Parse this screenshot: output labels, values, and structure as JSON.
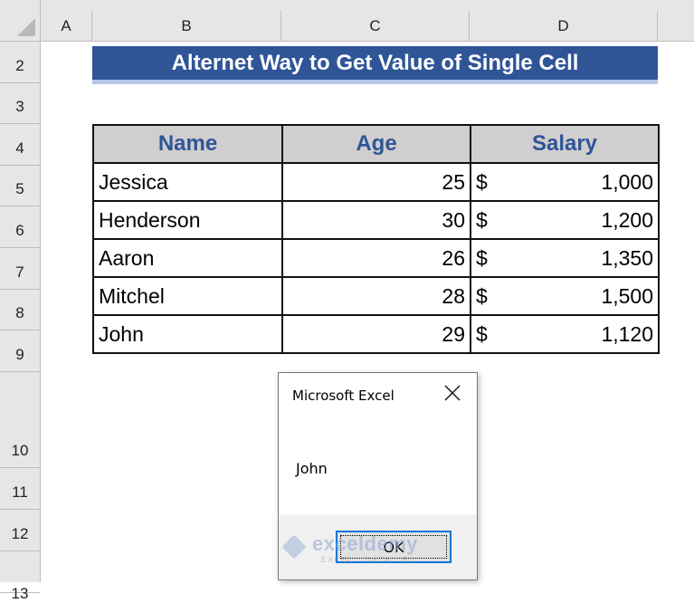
{
  "spreadsheet": {
    "columns": [
      "A",
      "B",
      "C",
      "D"
    ],
    "rows": [
      "2",
      "3",
      "4",
      "5",
      "6",
      "7",
      "8",
      "9",
      "10",
      "11",
      "12",
      "13"
    ]
  },
  "title": "Alternet Way to Get Value of Single Cell",
  "table": {
    "headers": [
      "Name",
      "Age",
      "Salary"
    ],
    "currency_symbol": "$",
    "rows": [
      {
        "name": "Jessica",
        "age": "25",
        "salary": "1,000"
      },
      {
        "name": "Henderson",
        "age": "30",
        "salary": "1,200"
      },
      {
        "name": "Aaron",
        "age": "26",
        "salary": "1,350"
      },
      {
        "name": "Mitchel",
        "age": "28",
        "salary": "1,500"
      },
      {
        "name": "John",
        "age": "29",
        "salary": "1,120"
      }
    ]
  },
  "dialog": {
    "title": "Microsoft Excel",
    "close_icon": "close-icon",
    "message": "John",
    "ok_label": "OK"
  },
  "watermark": {
    "brand": "exceldemy",
    "tagline": "EXCEL · DATA · BI"
  },
  "colors": {
    "title_band": "#2f5597",
    "header_fill": "#d0cece",
    "header_text": "#2f5597",
    "ok_button_border": "#0078d7"
  }
}
